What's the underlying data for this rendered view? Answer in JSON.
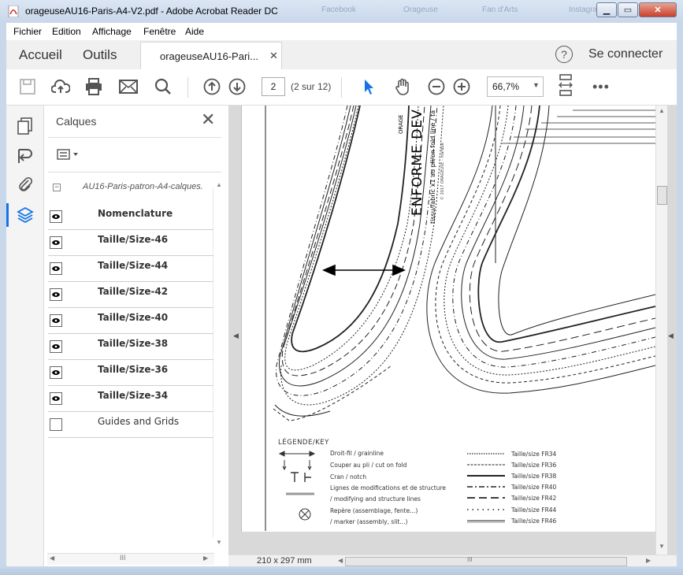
{
  "window": {
    "title": "orageuseAU16-Paris-A4-V2.pdf - Adobe Acrobat Reader DC",
    "ghost_tabs": [
      "Facebook",
      "Orageuse",
      "Fan d'Arts",
      "Instagram"
    ]
  },
  "menu": [
    "Fichier",
    "Edition",
    "Affichage",
    "Fenêtre",
    "Aide"
  ],
  "tabs": {
    "home": "Accueil",
    "tools": "Outils",
    "document": "orageuseAU16-Pari...",
    "help": "?",
    "signin": "Se connecter"
  },
  "toolbar": {
    "page_number": "2",
    "page_count": "(2 sur 12)",
    "zoom": "66,7%"
  },
  "layers_panel": {
    "title": "Calques",
    "root": "AU16-Paris-patron-A4-calques.",
    "layers": [
      {
        "name": "Nomenclature",
        "visible": true
      },
      {
        "name": "Taille/Size-46",
        "visible": true
      },
      {
        "name": "Taille/Size-44",
        "visible": true
      },
      {
        "name": "Taille/Size-42",
        "visible": true
      },
      {
        "name": "Taille/Size-40",
        "visible": true
      },
      {
        "name": "Taille/Size-38",
        "visible": true
      },
      {
        "name": "Taille/Size-36",
        "visible": true
      },
      {
        "name": "Taille/Size-34",
        "visible": true
      },
      {
        "name": "Guides and Grids",
        "visible": false
      }
    ]
  },
  "document": {
    "page_size": "210 x 297 mm",
    "pattern_title": "ENFORME DEV",
    "pattern_brand": "ORAGE",
    "pattern_note": "tissu/fabric x1 au pli/on fold line / ta",
    "pattern_copyright": "© 2017 ORAGEUSE - marque",
    "key_title": "LÉGENDE/KEY",
    "key_items": [
      "Droit-fil / grainline",
      "Couper au pli / cut on fold",
      "Cran / notch",
      "Lignes de modifications et de structure",
      "/ modifying and structure lines",
      "Repère (assemblage, fente...)",
      "/ marker (assembly, slit...)"
    ],
    "size_items": [
      "Taille/size FR34",
      "Taille/size FR36",
      "Taille/size FR38",
      "Taille/size FR40",
      "Taille/size FR42",
      "Taille/size FR44",
      "Taille/size FR46"
    ]
  }
}
